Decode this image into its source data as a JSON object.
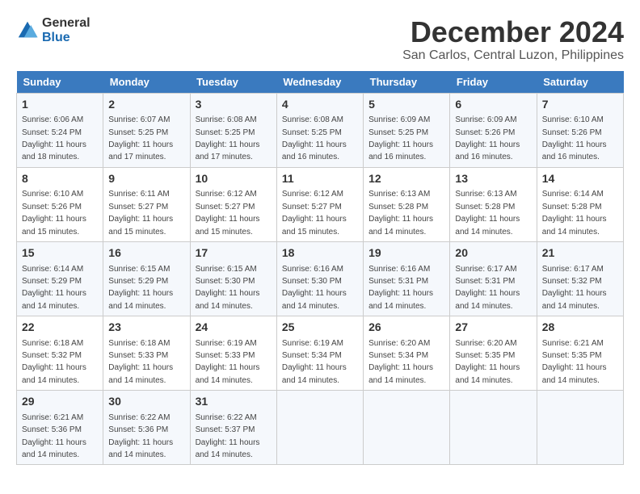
{
  "logo": {
    "text_general": "General",
    "text_blue": "Blue"
  },
  "title": {
    "month": "December 2024",
    "location": "San Carlos, Central Luzon, Philippines"
  },
  "weekdays": [
    "Sunday",
    "Monday",
    "Tuesday",
    "Wednesday",
    "Thursday",
    "Friday",
    "Saturday"
  ],
  "weeks": [
    [
      {
        "day": "1",
        "sunrise": "6:06 AM",
        "sunset": "5:24 PM",
        "daylight": "11 hours and 18 minutes."
      },
      {
        "day": "2",
        "sunrise": "6:07 AM",
        "sunset": "5:25 PM",
        "daylight": "11 hours and 17 minutes."
      },
      {
        "day": "3",
        "sunrise": "6:08 AM",
        "sunset": "5:25 PM",
        "daylight": "11 hours and 17 minutes."
      },
      {
        "day": "4",
        "sunrise": "6:08 AM",
        "sunset": "5:25 PM",
        "daylight": "11 hours and 16 minutes."
      },
      {
        "day": "5",
        "sunrise": "6:09 AM",
        "sunset": "5:25 PM",
        "daylight": "11 hours and 16 minutes."
      },
      {
        "day": "6",
        "sunrise": "6:09 AM",
        "sunset": "5:26 PM",
        "daylight": "11 hours and 16 minutes."
      },
      {
        "day": "7",
        "sunrise": "6:10 AM",
        "sunset": "5:26 PM",
        "daylight": "11 hours and 16 minutes."
      }
    ],
    [
      {
        "day": "8",
        "sunrise": "6:10 AM",
        "sunset": "5:26 PM",
        "daylight": "11 hours and 15 minutes."
      },
      {
        "day": "9",
        "sunrise": "6:11 AM",
        "sunset": "5:27 PM",
        "daylight": "11 hours and 15 minutes."
      },
      {
        "day": "10",
        "sunrise": "6:12 AM",
        "sunset": "5:27 PM",
        "daylight": "11 hours and 15 minutes."
      },
      {
        "day": "11",
        "sunrise": "6:12 AM",
        "sunset": "5:27 PM",
        "daylight": "11 hours and 15 minutes."
      },
      {
        "day": "12",
        "sunrise": "6:13 AM",
        "sunset": "5:28 PM",
        "daylight": "11 hours and 14 minutes."
      },
      {
        "day": "13",
        "sunrise": "6:13 AM",
        "sunset": "5:28 PM",
        "daylight": "11 hours and 14 minutes."
      },
      {
        "day": "14",
        "sunrise": "6:14 AM",
        "sunset": "5:28 PM",
        "daylight": "11 hours and 14 minutes."
      }
    ],
    [
      {
        "day": "15",
        "sunrise": "6:14 AM",
        "sunset": "5:29 PM",
        "daylight": "11 hours and 14 minutes."
      },
      {
        "day": "16",
        "sunrise": "6:15 AM",
        "sunset": "5:29 PM",
        "daylight": "11 hours and 14 minutes."
      },
      {
        "day": "17",
        "sunrise": "6:15 AM",
        "sunset": "5:30 PM",
        "daylight": "11 hours and 14 minutes."
      },
      {
        "day": "18",
        "sunrise": "6:16 AM",
        "sunset": "5:30 PM",
        "daylight": "11 hours and 14 minutes."
      },
      {
        "day": "19",
        "sunrise": "6:16 AM",
        "sunset": "5:31 PM",
        "daylight": "11 hours and 14 minutes."
      },
      {
        "day": "20",
        "sunrise": "6:17 AM",
        "sunset": "5:31 PM",
        "daylight": "11 hours and 14 minutes."
      },
      {
        "day": "21",
        "sunrise": "6:17 AM",
        "sunset": "5:32 PM",
        "daylight": "11 hours and 14 minutes."
      }
    ],
    [
      {
        "day": "22",
        "sunrise": "6:18 AM",
        "sunset": "5:32 PM",
        "daylight": "11 hours and 14 minutes."
      },
      {
        "day": "23",
        "sunrise": "6:18 AM",
        "sunset": "5:33 PM",
        "daylight": "11 hours and 14 minutes."
      },
      {
        "day": "24",
        "sunrise": "6:19 AM",
        "sunset": "5:33 PM",
        "daylight": "11 hours and 14 minutes."
      },
      {
        "day": "25",
        "sunrise": "6:19 AM",
        "sunset": "5:34 PM",
        "daylight": "11 hours and 14 minutes."
      },
      {
        "day": "26",
        "sunrise": "6:20 AM",
        "sunset": "5:34 PM",
        "daylight": "11 hours and 14 minutes."
      },
      {
        "day": "27",
        "sunrise": "6:20 AM",
        "sunset": "5:35 PM",
        "daylight": "11 hours and 14 minutes."
      },
      {
        "day": "28",
        "sunrise": "6:21 AM",
        "sunset": "5:35 PM",
        "daylight": "11 hours and 14 minutes."
      }
    ],
    [
      {
        "day": "29",
        "sunrise": "6:21 AM",
        "sunset": "5:36 PM",
        "daylight": "11 hours and 14 minutes."
      },
      {
        "day": "30",
        "sunrise": "6:22 AM",
        "sunset": "5:36 PM",
        "daylight": "11 hours and 14 minutes."
      },
      {
        "day": "31",
        "sunrise": "6:22 AM",
        "sunset": "5:37 PM",
        "daylight": "11 hours and 14 minutes."
      },
      null,
      null,
      null,
      null
    ]
  ],
  "labels": {
    "sunrise": "Sunrise: ",
    "sunset": "Sunset: ",
    "daylight": "Daylight: "
  }
}
